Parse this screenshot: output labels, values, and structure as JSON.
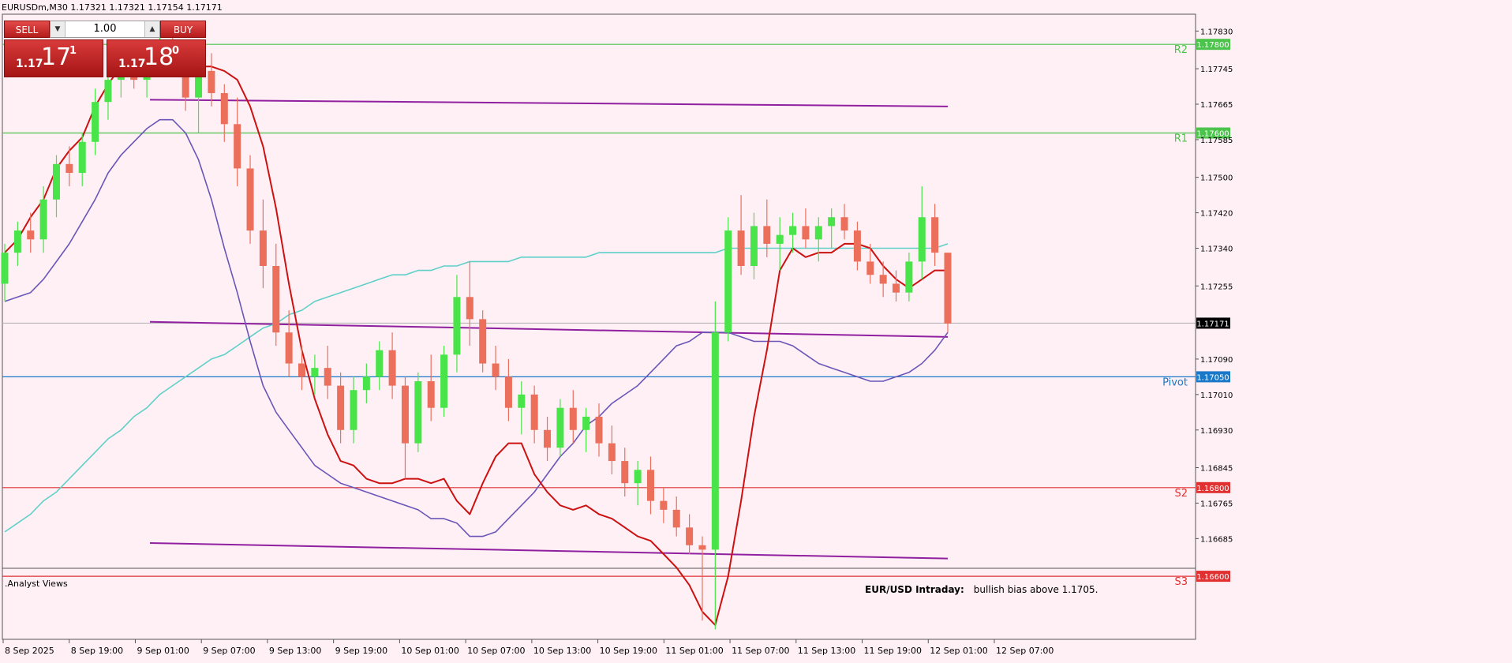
{
  "window": {
    "symbol_info": "EURUSDm,M30  1.17321 1.17321 1.17154 1.17171"
  },
  "trade_panel": {
    "sell_label": "SELL",
    "buy_label": "BUY",
    "lot_value": "1.00",
    "sell_price": {
      "small": "1.17",
      "big": "17",
      "sup": "1"
    },
    "buy_price": {
      "small": "1.17",
      "big": "18",
      "sup": "0"
    }
  },
  "colors": {
    "background": "#fff0f5",
    "bull_candle": "#49e449",
    "bear_candle": "#ec6f5c",
    "ma_fast": "#cc1111",
    "ma_mid": "#6a55b8",
    "ma_slow": "#5fd0c8",
    "channel": "#9020a0",
    "resistance": "#4cc44c",
    "pivot": "#1a78c8",
    "support": "#e03030"
  },
  "analyst": {
    "label": ".Analyst Views",
    "heading": "EUR/USD Intraday:",
    "text": "bullish bias above 1.1705."
  },
  "chart_data": {
    "type": "candlestick",
    "symbol": "EURUSDm",
    "timeframe": "M30",
    "ylim": [
      1.16618,
      1.17868
    ],
    "x_tick_labels": [
      "8 Sep 2025",
      "8 Sep 19:00",
      "9 Sep 01:00",
      "9 Sep 07:00",
      "9 Sep 13:00",
      "9 Sep 19:00",
      "10 Sep 01:00",
      "10 Sep 07:00",
      "10 Sep 13:00",
      "10 Sep 19:00",
      "11 Sep 01:00",
      "11 Sep 07:00",
      "11 Sep 13:00",
      "11 Sep 19:00",
      "12 Sep 01:00",
      "12 Sep 07:00"
    ],
    "y_ticks": [
      "1.17830",
      "1.17745",
      "1.17665",
      "1.17585",
      "1.17500",
      "1.17420",
      "1.17340",
      "1.17255",
      "1.17090",
      "1.17010",
      "1.16930",
      "1.16845",
      "1.16765",
      "1.16685"
    ],
    "current_price": "1.17171",
    "levels": [
      {
        "name": "R2",
        "price": "1.17800"
      },
      {
        "name": "R1",
        "price": "1.17600"
      },
      {
        "name": "Pivot",
        "price": "1.17050"
      },
      {
        "name": "S2",
        "price": "1.16800"
      },
      {
        "name": "S3",
        "price": "1.16600"
      }
    ],
    "ma_fast": [
      1.1733,
      1.1736,
      1.1741,
      1.1745,
      1.1752,
      1.1756,
      1.1759,
      1.1766,
      1.1771,
      1.1775,
      1.1776,
      1.1776,
      1.1777,
      1.1779,
      1.1777,
      1.1775,
      1.1775,
      1.1774,
      1.1772,
      1.1766,
      1.1757,
      1.1743,
      1.1726,
      1.1711,
      1.17,
      1.1692,
      1.1686,
      1.1685,
      1.1682,
      1.1681,
      1.1681,
      1.1682,
      1.1682,
      1.1681,
      1.1682,
      1.1677,
      1.1674,
      1.1681,
      1.1687,
      1.169,
      1.169,
      1.1683,
      1.1679,
      1.1676,
      1.1675,
      1.1676,
      1.1674,
      1.1673,
      1.1671,
      1.1669,
      1.1668,
      1.1665,
      1.1662,
      1.1658,
      1.1652,
      1.1649,
      1.166,
      1.1677,
      1.1696,
      1.1711,
      1.1729,
      1.1734,
      1.1732,
      1.1733,
      1.1733,
      1.1735,
      1.1735,
      1.1734,
      1.173,
      1.1727,
      1.1725,
      1.1727,
      1.1729,
      1.1729
    ],
    "ma_mid": [
      1.1722,
      1.1723,
      1.1724,
      1.1727,
      1.1731,
      1.1735,
      1.174,
      1.1745,
      1.1751,
      1.1755,
      1.1758,
      1.1761,
      1.1763,
      1.1763,
      1.176,
      1.1754,
      1.1745,
      1.1734,
      1.1724,
      1.1713,
      1.1703,
      1.1697,
      1.1693,
      1.1689,
      1.1685,
      1.1683,
      1.1681,
      1.168,
      1.1679,
      1.1678,
      1.1677,
      1.1676,
      1.1675,
      1.1673,
      1.1673,
      1.1672,
      1.1669,
      1.1669,
      1.167,
      1.1673,
      1.1676,
      1.1679,
      1.1683,
      1.1687,
      1.169,
      1.1694,
      1.1696,
      1.1699,
      1.1701,
      1.1703,
      1.1706,
      1.1709,
      1.1712,
      1.1713,
      1.1715,
      1.1715,
      1.1715,
      1.1714,
      1.1713,
      1.1713,
      1.1713,
      1.1712,
      1.171,
      1.1708,
      1.1707,
      1.1706,
      1.1705,
      1.1704,
      1.1704,
      1.1705,
      1.1706,
      1.1708,
      1.1711,
      1.1715
    ],
    "ma_slow": [
      1.167,
      1.1672,
      1.1674,
      1.1677,
      1.1679,
      1.1682,
      1.1685,
      1.1688,
      1.1691,
      1.1693,
      1.1696,
      1.1698,
      1.1701,
      1.1703,
      1.1705,
      1.1707,
      1.1709,
      1.171,
      1.1712,
      1.1714,
      1.1716,
      1.1717,
      1.1719,
      1.172,
      1.1722,
      1.1723,
      1.1724,
      1.1725,
      1.1726,
      1.1727,
      1.1728,
      1.1728,
      1.1729,
      1.1729,
      1.173,
      1.173,
      1.1731,
      1.1731,
      1.1731,
      1.1731,
      1.1732,
      1.1732,
      1.1732,
      1.1732,
      1.1732,
      1.1732,
      1.1733,
      1.1733,
      1.1733,
      1.1733,
      1.1733,
      1.1733,
      1.1733,
      1.1733,
      1.1733,
      1.1733,
      1.1734,
      1.1734,
      1.1734,
      1.1734,
      1.1734,
      1.1734,
      1.1734,
      1.1734,
      1.1734,
      1.1734,
      1.1734,
      1.1734,
      1.1734,
      1.1734,
      1.1734,
      1.1734,
      1.1734,
      1.1735
    ],
    "channel": [
      {
        "name": "upper",
        "x": [
          0.154,
          1.0
        ],
        "y": [
          1.17675,
          1.1766
        ]
      },
      {
        "name": "middle",
        "x": [
          0.154,
          1.0
        ],
        "y": [
          1.17174,
          1.1714
        ]
      },
      {
        "name": "lower",
        "x": [
          0.154,
          1.0
        ],
        "y": [
          1.16675,
          1.1664
        ]
      }
    ],
    "candles": [
      [
        1.1726,
        1.1735,
        1.1722,
        1.1733
      ],
      [
        1.1733,
        1.174,
        1.173,
        1.1738
      ],
      [
        1.1738,
        1.1742,
        1.1733,
        1.1736
      ],
      [
        1.1736,
        1.1748,
        1.1733,
        1.1745
      ],
      [
        1.1745,
        1.1755,
        1.1741,
        1.1753
      ],
      [
        1.1753,
        1.1757,
        1.1748,
        1.1751
      ],
      [
        1.1751,
        1.176,
        1.1748,
        1.1758
      ],
      [
        1.1758,
        1.177,
        1.1755,
        1.1767
      ],
      [
        1.1767,
        1.1775,
        1.1763,
        1.1772
      ],
      [
        1.1772,
        1.1778,
        1.1768,
        1.1775
      ],
      [
        1.1775,
        1.1779,
        1.177,
        1.1772
      ],
      [
        1.1772,
        1.1778,
        1.1768,
        1.1776
      ],
      [
        1.1776,
        1.1782,
        1.1773,
        1.1779
      ],
      [
        1.1779,
        1.1784,
        1.1775,
        1.1777
      ],
      [
        1.1777,
        1.1779,
        1.1765,
        1.1768
      ],
      [
        1.1768,
        1.1776,
        1.176,
        1.1774
      ],
      [
        1.1774,
        1.1778,
        1.1766,
        1.1769
      ],
      [
        1.1769,
        1.1771,
        1.1758,
        1.1762
      ],
      [
        1.1762,
        1.1768,
        1.1748,
        1.1752
      ],
      [
        1.1752,
        1.1755,
        1.1735,
        1.1738
      ],
      [
        1.1738,
        1.1745,
        1.1725,
        1.173
      ],
      [
        1.173,
        1.1735,
        1.1712,
        1.1715
      ],
      [
        1.1715,
        1.172,
        1.1705,
        1.1708
      ],
      [
        1.1708,
        1.1712,
        1.1702,
        1.1705
      ],
      [
        1.1705,
        1.171,
        1.1701,
        1.1707
      ],
      [
        1.1707,
        1.1712,
        1.17,
        1.1703
      ],
      [
        1.1703,
        1.1706,
        1.169,
        1.1693
      ],
      [
        1.1693,
        1.1705,
        1.169,
        1.1702
      ],
      [
        1.1702,
        1.1708,
        1.1699,
        1.1705
      ],
      [
        1.1705,
        1.1713,
        1.1702,
        1.1711
      ],
      [
        1.1711,
        1.1715,
        1.17,
        1.1703
      ],
      [
        1.1703,
        1.1705,
        1.1682,
        1.169
      ],
      [
        1.169,
        1.1706,
        1.1688,
        1.1704
      ],
      [
        1.1704,
        1.171,
        1.1695,
        1.1698
      ],
      [
        1.1698,
        1.1712,
        1.1696,
        1.171
      ],
      [
        1.171,
        1.1728,
        1.1706,
        1.1723
      ],
      [
        1.1723,
        1.1731,
        1.1712,
        1.1718
      ],
      [
        1.1718,
        1.172,
        1.1706,
        1.1708
      ],
      [
        1.1708,
        1.1712,
        1.1702,
        1.1705
      ],
      [
        1.1705,
        1.1709,
        1.1695,
        1.1698
      ],
      [
        1.1698,
        1.1704,
        1.1692,
        1.1701
      ],
      [
        1.1701,
        1.1703,
        1.169,
        1.1693
      ],
      [
        1.1693,
        1.1696,
        1.1686,
        1.1689
      ],
      [
        1.1689,
        1.17,
        1.1687,
        1.1698
      ],
      [
        1.1698,
        1.1702,
        1.169,
        1.1693
      ],
      [
        1.1693,
        1.1698,
        1.1688,
        1.1696
      ],
      [
        1.1696,
        1.1699,
        1.1687,
        1.169
      ],
      [
        1.169,
        1.1694,
        1.1683,
        1.1686
      ],
      [
        1.1686,
        1.1689,
        1.1678,
        1.1681
      ],
      [
        1.1681,
        1.1686,
        1.1676,
        1.1684
      ],
      [
        1.1684,
        1.1687,
        1.1674,
        1.1677
      ],
      [
        1.1677,
        1.168,
        1.1672,
        1.1675
      ],
      [
        1.1675,
        1.1678,
        1.1669,
        1.1671
      ],
      [
        1.1671,
        1.1674,
        1.1665,
        1.1667
      ],
      [
        1.1667,
        1.1669,
        1.165,
        1.1666
      ],
      [
        1.1666,
        1.1722,
        1.1648,
        1.1715
      ],
      [
        1.1715,
        1.1741,
        1.1713,
        1.1738
      ],
      [
        1.1738,
        1.1746,
        1.1728,
        1.173
      ],
      [
        1.173,
        1.1742,
        1.1727,
        1.1739
      ],
      [
        1.1739,
        1.1745,
        1.1732,
        1.1735
      ],
      [
        1.1735,
        1.1741,
        1.1729,
        1.1737
      ],
      [
        1.1737,
        1.1742,
        1.1733,
        1.1739
      ],
      [
        1.1739,
        1.1743,
        1.1734,
        1.1736
      ],
      [
        1.1736,
        1.1741,
        1.1731,
        1.1739
      ],
      [
        1.1739,
        1.1743,
        1.1734,
        1.1741
      ],
      [
        1.1741,
        1.1744,
        1.1736,
        1.1738
      ],
      [
        1.1738,
        1.174,
        1.1729,
        1.1731
      ],
      [
        1.1731,
        1.1735,
        1.1726,
        1.1728
      ],
      [
        1.1728,
        1.1731,
        1.1723,
        1.1726
      ],
      [
        1.1726,
        1.1729,
        1.1722,
        1.1724
      ],
      [
        1.1724,
        1.1733,
        1.1722,
        1.1731
      ],
      [
        1.1731,
        1.1748,
        1.1727,
        1.1741
      ],
      [
        1.1741,
        1.1744,
        1.173,
        1.1733
      ],
      [
        1.1733,
        1.1733,
        1.1715,
        1.1717
      ]
    ]
  }
}
